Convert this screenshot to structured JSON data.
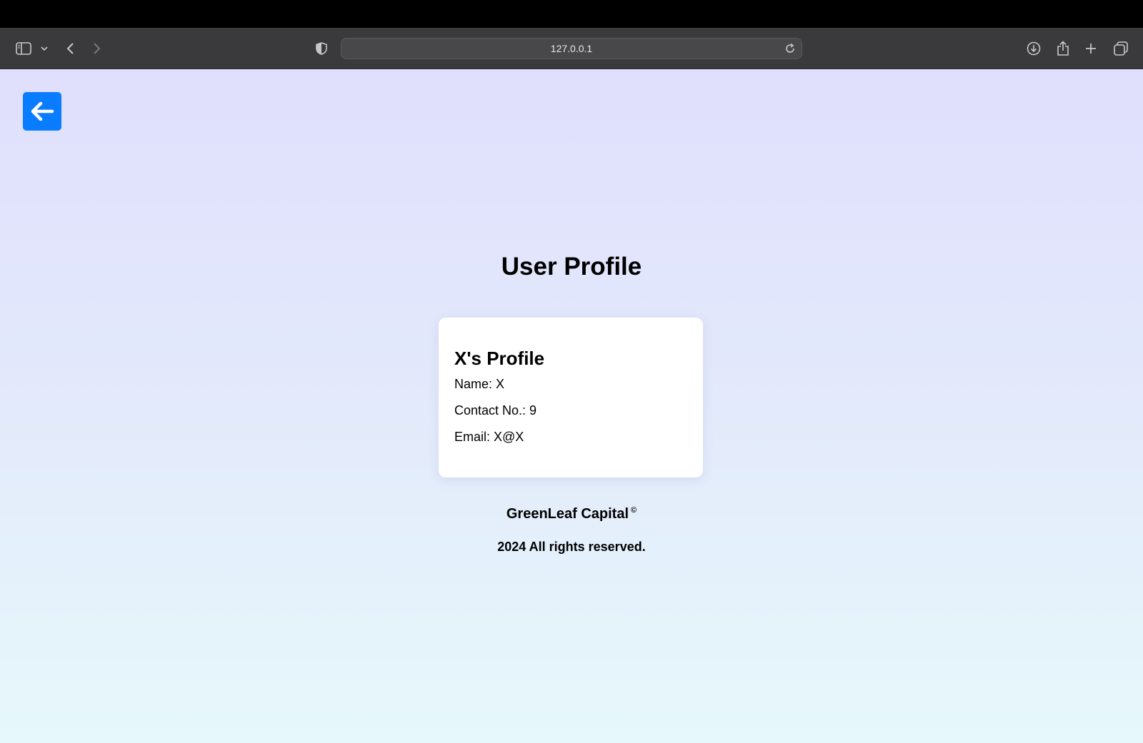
{
  "browser": {
    "url": "127.0.0.1",
    "icons": {
      "sidebar": "sidebar-icon",
      "tab_dropdown": "chevron-down-icon",
      "back": "chevron-left-icon",
      "forward": "chevron-right-icon",
      "privacy": "shield-icon",
      "reload": "reload-icon",
      "downloads": "download-icon",
      "share": "share-icon",
      "new_tab": "plus-icon",
      "tabs_overview": "tabs-icon"
    }
  },
  "page": {
    "back_button_icon": "arrow-left-icon",
    "title": "User Profile",
    "profile_card": {
      "heading": "X's Profile",
      "name_line": "Name: X",
      "contact_line": "Contact No.: 9",
      "email_line": "Email: X@X"
    },
    "footer": {
      "brand": "GreenLeaf Capital",
      "copyright_symbol": "©",
      "rights": "2024 All rights reserved."
    },
    "colors": {
      "accent": "#0a7cff",
      "background_top": "#e0dffd",
      "background_bottom": "#e6f8fb",
      "card": "#ffffff",
      "toolbar": "#3a3a3c"
    }
  }
}
